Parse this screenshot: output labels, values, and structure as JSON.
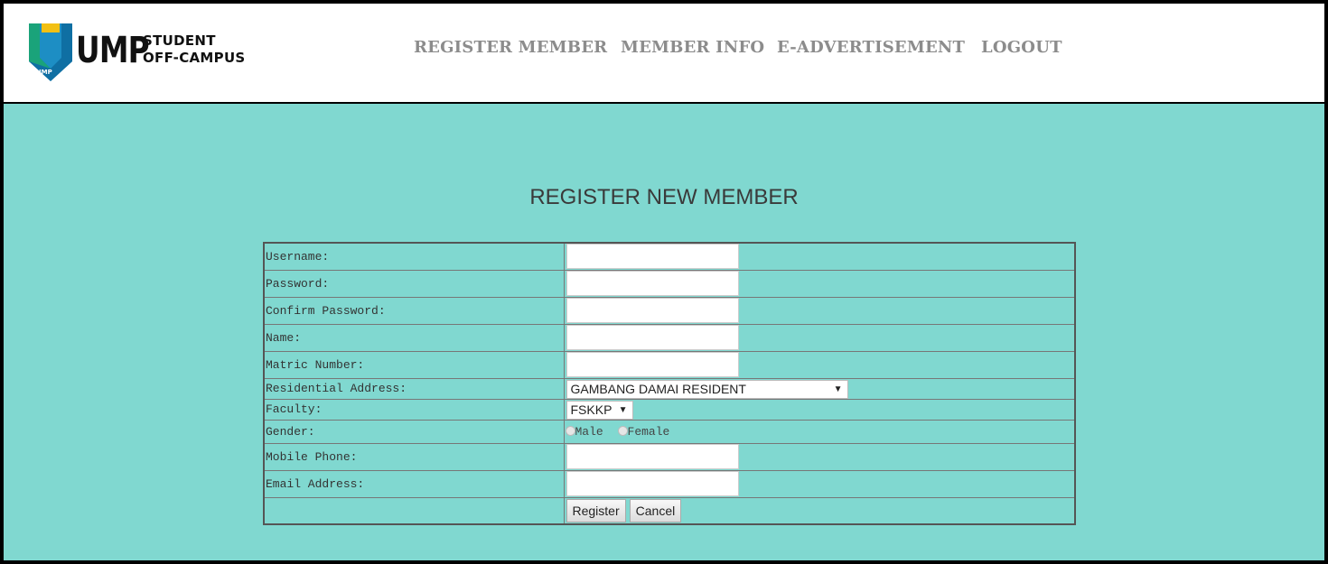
{
  "header": {
    "logo": {
      "ump": "UMP",
      "badge": "UMP",
      "line1": "STUDENT",
      "line2": "OFF-CAMPUS"
    },
    "nav": [
      "REGISTER MEMBER",
      "MEMBER INFO",
      "E-ADVERTISEMENT",
      "LOGOUT"
    ]
  },
  "main": {
    "title": "REGISTER NEW MEMBER",
    "fields": {
      "username": {
        "label": "Username:",
        "value": ""
      },
      "password": {
        "label": "Password:",
        "value": ""
      },
      "confirm_password": {
        "label": "Confirm Password:",
        "value": ""
      },
      "name": {
        "label": "Name:",
        "value": ""
      },
      "matric": {
        "label": "Matric Number:",
        "value": ""
      },
      "residential": {
        "label": "Residential Address:",
        "selected": "GAMBANG DAMAI RESIDENT"
      },
      "faculty": {
        "label": "Faculty:",
        "selected": "FSKKP"
      },
      "gender": {
        "label": "Gender:",
        "options": [
          "Male",
          "Female"
        ]
      },
      "mobile": {
        "label": "Mobile Phone:",
        "value": ""
      },
      "email": {
        "label": "Email Address:",
        "value": ""
      }
    },
    "buttons": {
      "register": "Register",
      "cancel": "Cancel"
    }
  },
  "colors": {
    "background": "#80d8d0",
    "header": "#ffffff",
    "nav_text": "#8c8c8c",
    "logo_blue": "#1d8ec4",
    "logo_yellow": "#f2c014"
  }
}
